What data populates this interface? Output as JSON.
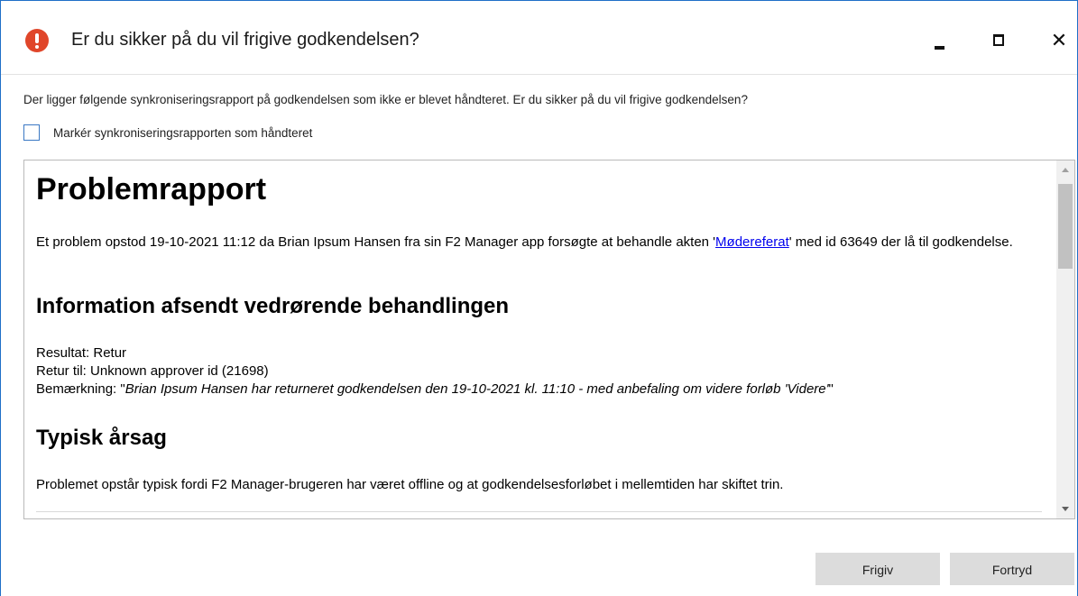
{
  "dialog": {
    "title": "Er du sikker på du vil frigive godkendelsen?",
    "icon": "warning-icon",
    "close_glyph": "✕"
  },
  "prompt": "Der ligger følgende synkroniseringsrapport på godkendelsen som ikke er blevet håndteret. Er du sikker på du vil frigive godkendelsen?",
  "checkbox": {
    "label": "Markér synkroniseringsrapporten som håndteret",
    "checked": false
  },
  "report": {
    "title": "Problemrapport",
    "intro_before_link": "Et problem opstod 19-10-2021 11:12 da Brian Ipsum Hansen fra sin F2 Manager app forsøgte at behandle akten '",
    "link_text": "Mødereferat",
    "intro_after_link": "' med id 63649 der lå til godkendelse.",
    "info_heading": "Information afsendt vedrørende behandlingen",
    "result_line": "Resultat: Retur",
    "return_to_line": "Retur til: Unknown approver id (21698)",
    "remark_label": "Bemærkning: \"",
    "remark_text": "Brian Ipsum Hansen har returneret godkendelsen den 19-10-2021 kl. 11:10 - med anbefaling om videre forløb 'Videre'",
    "remark_close": "\"",
    "cause_heading": "Typisk årsag",
    "cause_text": "Problemet opstår typisk fordi F2 Manager-brugeren har været offline og at godkendelsesforløbet i mellemtiden har skiftet trin."
  },
  "buttons": {
    "release": "Frigiv",
    "cancel": "Fortryd"
  },
  "colors": {
    "warning": "#e0462a",
    "link": "#0000ee",
    "button_bg": "#dcdcdc",
    "window_border": "#1f6fc7"
  }
}
